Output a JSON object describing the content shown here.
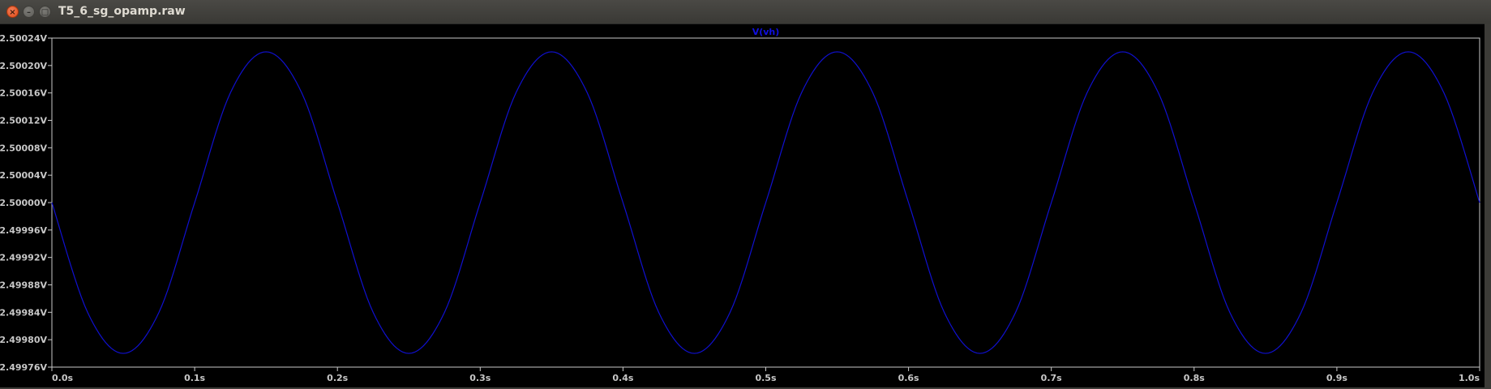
{
  "window": {
    "title": "T5_6_sg_opamp.raw",
    "close_glyph": "×",
    "min_glyph": "–",
    "max_glyph": "□"
  },
  "colors": {
    "background": "#000000",
    "frame": "#c8c8c8",
    "trace": "#1010d0",
    "tick_text": "#c8c8c8"
  },
  "chart_data": {
    "type": "line",
    "title": "",
    "trace_label": "V(vh)",
    "xlabel": "",
    "ylabel": "",
    "xlim": [
      0.0,
      1.0
    ],
    "ylim": [
      2.49976,
      2.50024
    ],
    "grid": false,
    "x_ticks": [
      0.0,
      0.1,
      0.2,
      0.3,
      0.4,
      0.5,
      0.6,
      0.7,
      0.8,
      0.9,
      1.0
    ],
    "x_tick_labels": [
      "0.0s",
      "0.1s",
      "0.2s",
      "0.3s",
      "0.4s",
      "0.5s",
      "0.6s",
      "0.7s",
      "0.8s",
      "0.9s",
      "1.0s"
    ],
    "y_ticks": [
      2.50024,
      2.5002,
      2.50016,
      2.50012,
      2.50008,
      2.50004,
      2.5,
      2.49996,
      2.49992,
      2.49988,
      2.49984,
      2.4998,
      2.49976
    ],
    "y_tick_labels": [
      "2.50024V",
      "2.50020V",
      "2.50016V",
      "2.50012V",
      "2.50008V",
      "2.50004V",
      "2.50000V",
      "2.49996V",
      "2.49992V",
      "2.49988V",
      "2.49984V",
      "2.49980V",
      "2.49976V"
    ],
    "series": [
      {
        "x": [
          0.0,
          0.025,
          0.05,
          0.075,
          0.1,
          0.125,
          0.15,
          0.175,
          0.2,
          0.225,
          0.25,
          0.275,
          0.3,
          0.325,
          0.35,
          0.375,
          0.4,
          0.425,
          0.45,
          0.475,
          0.5,
          0.525,
          0.55,
          0.575,
          0.6,
          0.625,
          0.65,
          0.675,
          0.7,
          0.725,
          0.75,
          0.775,
          0.8,
          0.825,
          0.85,
          0.875,
          0.9,
          0.925,
          0.95,
          0.975,
          1.0
        ],
        "values": [
          2.5,
          2.49984,
          2.49978,
          2.49984,
          2.5,
          2.50016,
          2.50022,
          2.50016,
          2.5,
          2.49984,
          2.49978,
          2.49984,
          2.5,
          2.50016,
          2.50022,
          2.50016,
          2.5,
          2.49984,
          2.49978,
          2.49984,
          2.5,
          2.50016,
          2.50022,
          2.50016,
          2.5,
          2.49984,
          2.49978,
          2.49984,
          2.5,
          2.50016,
          2.50022,
          2.50016,
          2.5,
          2.49984,
          2.49978,
          2.49984,
          2.5,
          2.50016,
          2.50022,
          2.50016,
          2.5
        ]
      }
    ]
  }
}
